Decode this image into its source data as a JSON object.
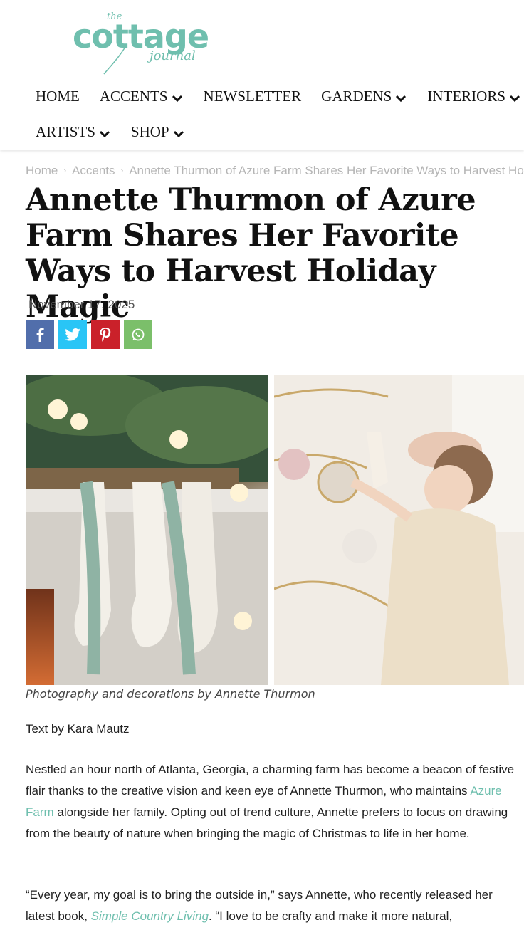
{
  "logo": {
    "the": "the",
    "word": "cottage",
    "journal": "journal"
  },
  "nav": {
    "items": [
      {
        "label": "HOME",
        "has_menu": false
      },
      {
        "label": "ACCENTS",
        "has_menu": true
      },
      {
        "label": "NEWSLETTER",
        "has_menu": false
      },
      {
        "label": "GARDENS",
        "has_menu": true
      },
      {
        "label": "INTERIORS",
        "has_menu": true
      },
      {
        "label": "ARTISTS",
        "has_menu": true
      },
      {
        "label": "SHOP",
        "has_menu": true
      }
    ]
  },
  "breadcrumb": {
    "home": "Home",
    "section": "Accents",
    "current": "Annette Thurmon of Azure Farm Shares Her Favorite Ways to Harvest Holiday Magic"
  },
  "article": {
    "title": "Annette Thurmon of Azure Farm Shares Her Favorite Ways to Harvest Holiday Magic",
    "date": "November 17, 2025",
    "caption": "Photography and decorations by Annette Thurmon",
    "byline": "Text by Kara Mautz",
    "p1_before": "Nestled an hour north of Atlanta, Georgia, a charming farm has become a beacon of festive flair thanks to the creative vision and keen eye of Annette Thurmon, who maintains ",
    "p1_link": "Azure Farm",
    "p1_after": " alongside her family. Opting out of trend culture, Annette prefers to focus on drawing from the beauty of nature when bringing the magic of Christmas to life in her home.",
    "p2_before": "“Every year, my goal is to bring the outside in,” says Annette, who recently released her latest book, ",
    "p2_link": "Simple Country Living",
    "p2_after": ". “I love to be crafty and make it more natural,"
  },
  "social": {
    "facebook": "f",
    "twitter": "t",
    "pinterest": "P",
    "whatsapp": "w"
  },
  "colors": {
    "brand": "#6fbfae",
    "facebook": "#516eab",
    "twitter": "#29c5f6",
    "pinterest": "#ca212a",
    "whatsapp": "#7bbf6a"
  }
}
